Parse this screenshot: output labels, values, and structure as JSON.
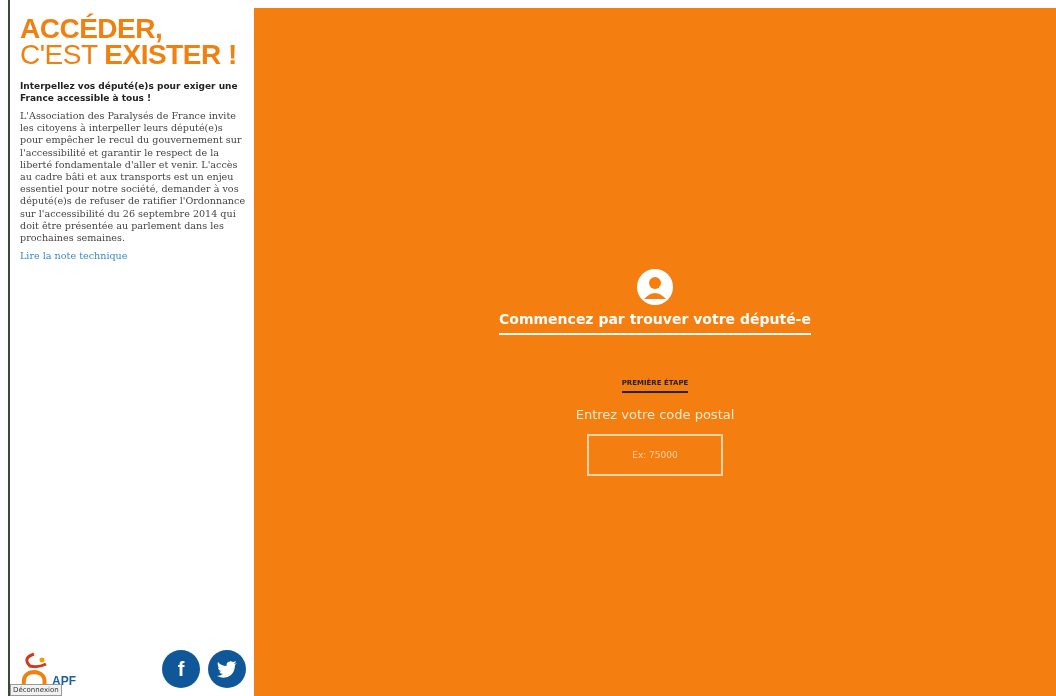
{
  "sidebar": {
    "title_lines": [
      "**ACCÉDER,**",
      "C'EST **EXISTER !**"
    ],
    "subtitle": "Interpellez vos député(e)s pour exiger une France accessible à tous !",
    "body": "L'Association des Paralysés de France invite les citoyens à interpeller leurs député(e)s pour empêcher le recul du gouvernement sur l'accessibilité et garantir le respect de la liberté fondamentale d'aller et venir. L'accès au cadre bâti et aux transports est un enjeu essentiel pour notre société, demander à vos député(e)s de refuser de ratifier l'Ordonnance sur l'accessibilité du 26 septembre 2014 qui doit être présentée au parlement dans les prochaines semaines.",
    "link": "Lire la note technique",
    "logo": "APF",
    "tooltip": "Déconnexion",
    "social": [
      {
        "kind": "facebook",
        "label": "f"
      },
      {
        "kind": "twitter"
      }
    ]
  },
  "main": {
    "heading": "Commencez par trouver votre député-e",
    "step": "PREMIÈRE ÉTAPE",
    "prompt": "Entrez votre code postal",
    "postal_field": {
      "placeholder": "Ex: 75000"
    }
  }
}
